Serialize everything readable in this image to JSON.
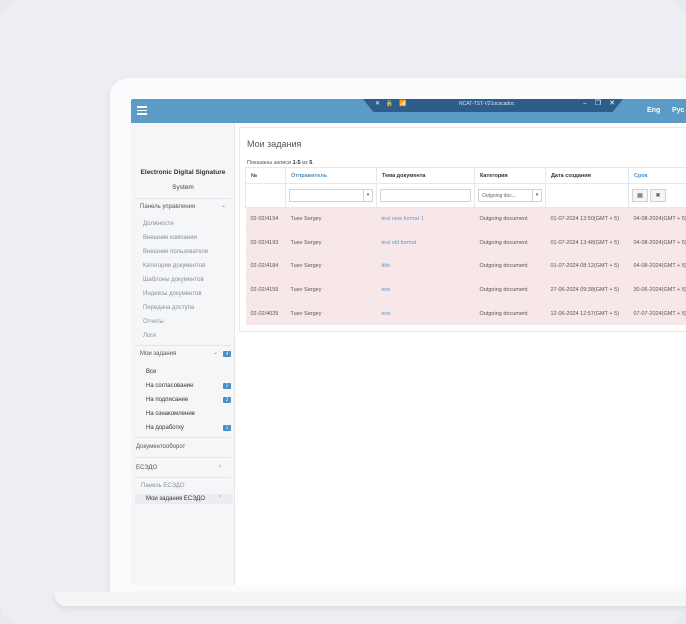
{
  "topbar": {
    "remote_title": "NCAT-TST-V21ocscadoc",
    "remote_icons": "✕ 🔒 📶",
    "remote_controls": "– ❐ ✕",
    "lang_eng": "Eng",
    "lang_rus": "Рус"
  },
  "sidebar": {
    "brand_title": "Electronic Digital Signature",
    "brand_sub": "System",
    "control_panel": "Панель управления",
    "items": [
      "Должности",
      "Внешние компании",
      "Внешние пользователи",
      "Категории документов",
      "Шаблоны документов",
      "Индексы документов",
      "Передача доступа",
      "Отчеты",
      "Логи"
    ],
    "my_tasks": "Мои задания",
    "my_tasks_badge": "4",
    "tasks": [
      {
        "label": "Все",
        "badge": ""
      },
      {
        "label": "На согласование",
        "badge": "1"
      },
      {
        "label": "На подписание",
        "badge": "2"
      },
      {
        "label": "На ознакомление",
        "badge": ""
      },
      {
        "label": "На доработку",
        "badge": "1"
      }
    ],
    "docflow": "Документооборот",
    "esedo": "ЕСЭДО",
    "esedo_panel": "Панель ЕСЭДО",
    "esedo_tasks": "Мои задания ЕСЭДО"
  },
  "content": {
    "title": "Мои задания",
    "records_prefix": "Показаны записи ",
    "records_range": "1-5",
    "records_mid": " из ",
    "records_total": "5",
    "records_suffix": ".",
    "columns": [
      "№",
      "Отправитель",
      "Тема документа",
      "Категория",
      "Дата создания",
      "Срок"
    ],
    "category_filter": "Outgoing doc...",
    "rows": [
      [
        "02-02/4194",
        "Tuev Sergey",
        "test new format 1",
        "Outgoing document",
        "01-07-2024 13:50(GMT + 5)",
        "04-08-2024(GMT + 5)"
      ],
      [
        "02-02/4193",
        "Tuev Sergey",
        "test old format",
        "Outgoing document",
        "01-07-2024 13:48(GMT + 5)",
        "04-08-2024(GMT + 5)"
      ],
      [
        "02-02/4184",
        "Tuev Sergey",
        "title",
        "Outgoing document",
        "01-07-2024 08:12(GMT + 5)",
        "04-08-2024(GMT + 5)"
      ],
      [
        "02-02/4159",
        "Tuev Sergey",
        "tew",
        "Outgoing document",
        "27-06-2024 09:38(GMT + 5)",
        "30-06-2024(GMT + 5)"
      ],
      [
        "02-02/4029",
        "Tuev Sergey",
        "test",
        "Outgoing document",
        "12-06-2024 12:57(GMT + 5)",
        "07-07-2024(GMT + 5)"
      ]
    ]
  }
}
